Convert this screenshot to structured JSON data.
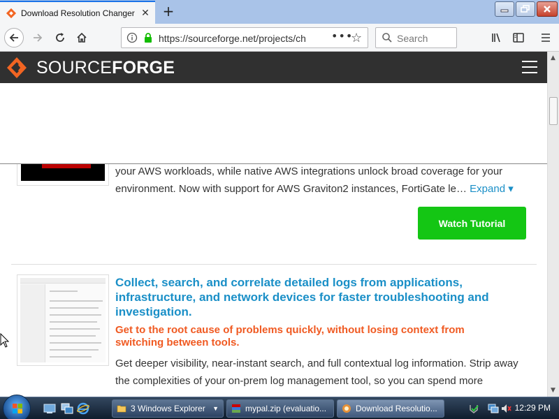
{
  "browser": {
    "tab_title": "Download Resolution Changer",
    "url": "https://sourceforge.net/projects/ch",
    "search_placeholder": "Search"
  },
  "site": {
    "brand_light": "SOURCE",
    "brand_bold": "FORGE",
    "brand_color": "#f26522",
    "header_bg": "#303030"
  },
  "card1": {
    "body": "your AWS workloads, while native AWS integrations unlock broad coverage for your environment. Now with support for AWS Graviton2 instances, FortiGate le…",
    "expand_label": "Expand ▾",
    "cta_label": "Watch Tutorial",
    "cta_color": "#14c614"
  },
  "card2": {
    "title": "Collect, search, and correlate detailed logs from applications, infrastructure, and network devices for faster troubleshooting and investigation.",
    "subtitle": "Get to the root cause of problems quickly, without losing context from switching between tools.",
    "body": "Get deeper visibility, near-instant search, and full contextual log information.  Strip away the complexities of your on-prem log management tool, so you can spend more",
    "title_color": "#1a8fc7",
    "subtitle_color": "#f05a22"
  },
  "taskbar": {
    "items": [
      {
        "label": "3 Windows Explorer",
        "icon": "folder-icon"
      },
      {
        "label": "mypal.zip (evaluatio...",
        "icon": "winrar-icon"
      },
      {
        "label": "Download Resolutio...",
        "icon": "browser-icon"
      }
    ],
    "clock": "12:29 PM"
  }
}
